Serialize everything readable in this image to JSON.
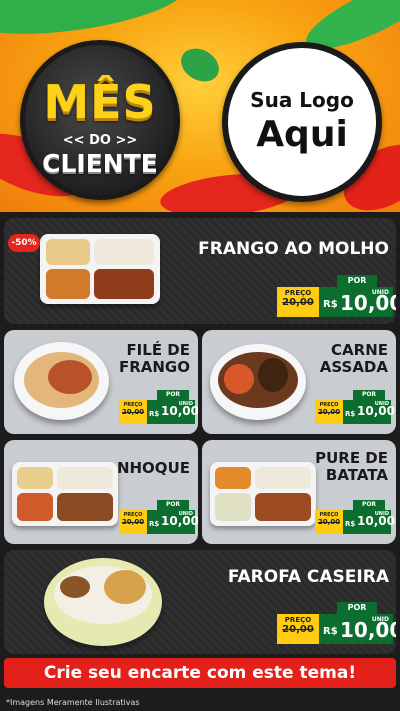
{
  "badge": {
    "line1": "MÊS",
    "line2": "<< DO >>",
    "line3": "CLIENTE"
  },
  "logo": {
    "line1": "Sua Logo",
    "line2": "Aqui"
  },
  "discount": "-50%",
  "products": [
    {
      "name": "FRANGO AO MOLHO",
      "por": "POR",
      "preco": "PREÇO",
      "old": "20,00",
      "currency": "R$",
      "value": "10,00",
      "unit": "UNID"
    },
    {
      "name_line1": "FILÉ DE",
      "name_line2": "FRANGO",
      "por": "POR",
      "preco": "PREÇO",
      "old": "20,00",
      "currency": "R$",
      "value": "10,00",
      "unit": "UNID"
    },
    {
      "name_line1": "CARNE",
      "name_line2": "ASSADA",
      "por": "POR",
      "preco": "PREÇO",
      "old": "20,00",
      "currency": "R$",
      "value": "10,00",
      "unit": "UNID"
    },
    {
      "name": "NHOQUE",
      "por": "POR",
      "preco": "PREÇO",
      "old": "20,00",
      "currency": "R$",
      "value": "10,00",
      "unit": "UNID"
    },
    {
      "name_line1": "PURE DE",
      "name_line2": "BATATA",
      "por": "POR",
      "preco": "PREÇO",
      "old": "20,00",
      "currency": "R$",
      "value": "10,00",
      "unit": "UNID"
    },
    {
      "name": "FAROFA CASEIRA",
      "por": "POR",
      "preco": "PREÇO",
      "old": "20,00",
      "currency": "R$",
      "value": "10,00",
      "unit": "UNID"
    }
  ],
  "cta": "Crie seu encarte com este tema!",
  "footnote": "*Imagens Meramente Ilustrativas",
  "colors": {
    "accent_red": "#e4201a",
    "price_green": "#0b6e2f",
    "price_yellow": "#ffcc12",
    "badge_gold": "#ffd21a"
  }
}
